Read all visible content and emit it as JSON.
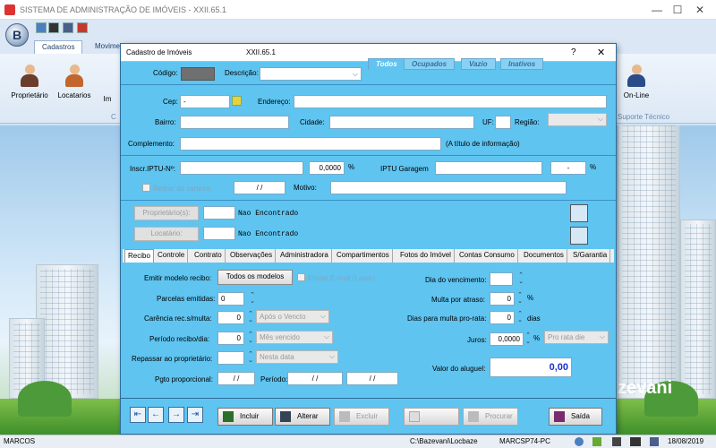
{
  "app": {
    "title": "SISTEMA DE ADMINISTRAÇÃO DE IMÓVEIS - XXII.65.1",
    "logo_letter": "B",
    "window_min": "—",
    "window_max": "☐",
    "window_close": "✕"
  },
  "ribbon": {
    "tabs": [
      "Cadastros",
      "Movimento"
    ],
    "buttons": [
      "Proprietário",
      "Locatarios",
      "Im",
      "On-Line"
    ],
    "group_left": "C",
    "group_right": "Suporte Técnico"
  },
  "dialog": {
    "title": "Cadastro de Imóveis",
    "version": "XXII.65.1",
    "help": "?",
    "close": "✕",
    "filter_tabs": [
      "Todos",
      "Ocupados",
      "Vazio",
      "Inativos"
    ],
    "codigo_label": "Código:",
    "descricao_label": "Descrição:",
    "cep_label": "Cep:",
    "cep_value": "-",
    "endereco_label": "Endereço:",
    "bairro_label": "Bairro:",
    "cidade_label": "Cidade:",
    "uf_label": "UF:",
    "regiao_label": "Região:",
    "complemento_label": "Complemento:",
    "complemento_hint": "(A título de informação)",
    "iptu_label": "Inscr.IPTU-Nº:",
    "iptu_value": "0,0000",
    "pct": "%",
    "iptu_garagem_label": "IPTU Garagem",
    "iptu_garagem_value": "-",
    "retirar_label": "Retirar da carteira",
    "retirar_date": "/ /",
    "motivo_label": "Motivo:",
    "proprietario_btn": "Proprietário(s):",
    "locatario_btn": "Locatário:",
    "nao_encontrado": "Nao Encontrado"
  },
  "page_tabs": [
    "Recibo",
    "Controle",
    "Contrato",
    "Observações",
    "Administradora",
    "Compartimentos",
    "Fotos do Imóvel",
    "Contas Consumo",
    "Documentos",
    "S/Garantia"
  ],
  "recibo": {
    "emitir_label": "Emitir modelo recibo:",
    "emitir_btn": "Todos os modelos",
    "enviar_email": "Enviar E-mail (Laser)",
    "parcelas_label": "Parcelas emitidas:",
    "parcelas_value": "0",
    "carencia_label": "Carência rec.s/multa:",
    "carencia_value": "0",
    "carencia_combo": "Após o Vencto",
    "periodo_label": "Período recibo/dia:",
    "periodo_value": "0",
    "periodo_combo": "Mês vencido",
    "repassar_label": "Repassar ao proprietário:",
    "repassar_combo": "Nesta data",
    "pgto_label": "Pgto proporcional:",
    "pgto_date": "/ /",
    "periodo2_label": "Período:",
    "periodo2_from": "/ /",
    "periodo2_to": "/ /",
    "dia_venc_label": "Dia do vencimento:",
    "multa_label": "Multa por atraso:",
    "multa_value": "0",
    "dias_multa_label": "Dias para multa pro-rata:",
    "dias_multa_value": "0",
    "dias_unit": "dias",
    "juros_label": "Juros:",
    "juros_value": "0,0000",
    "juros_combo": "Pro rata die",
    "valor_label": "Valor do aluguel:",
    "valor_value": "0,00"
  },
  "toolbar": {
    "nav": [
      "⇤",
      "←",
      "→",
      "⇥"
    ],
    "incluir": "Incluir",
    "alterar": "Alterar",
    "excluir": "Excluir",
    "procurar": "Procurar",
    "saida": "Saída"
  },
  "statusbar": {
    "user": "MARCOS",
    "path": "C:\\Bazevani\\Locbaze",
    "machine": "MARCSP74-PC",
    "date": "18/08/2019"
  },
  "brand_watermark": "zevani",
  "colors": {
    "dialog_bg": "#5fc4f0",
    "valor_text": "#1a2fd0"
  }
}
